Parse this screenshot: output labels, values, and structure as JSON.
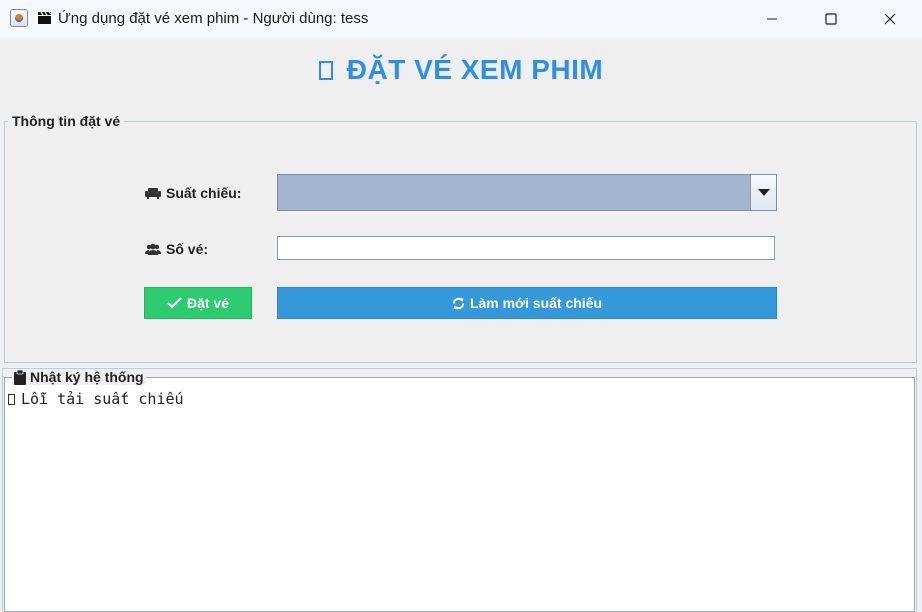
{
  "window": {
    "title": "Ứng dụng đặt vé xem phim - Người dùng: tess",
    "app_icon": "java-cup-icon",
    "title_icon": "clapperboard-icon",
    "controls": [
      "minimize-icon",
      "maximize-icon",
      "close-icon"
    ]
  },
  "header": {
    "title": "ĐẶT VÉ XEM PHIM",
    "color": "#2f8ee8"
  },
  "booking_panel": {
    "legend": "Thông tin đặt vé",
    "showtime_label": "Suất chiếu:",
    "showtime_icon": "couch-icon",
    "showtime_value": "",
    "ticket_label": "Số vé:",
    "ticket_icon": "users-icon",
    "ticket_value": "",
    "book_button": "Đặt vé",
    "book_icon": "check-icon",
    "book_color": "#2ecc71",
    "refresh_button": "Làm mới suất chiếu",
    "refresh_icon": "refresh-icon",
    "refresh_color": "#3498db"
  },
  "log": {
    "legend": "Nhật ký hệ thống",
    "legend_icon": "clipboard-icon",
    "lines": [
      "Lỗi tải suất chiếu"
    ]
  }
}
